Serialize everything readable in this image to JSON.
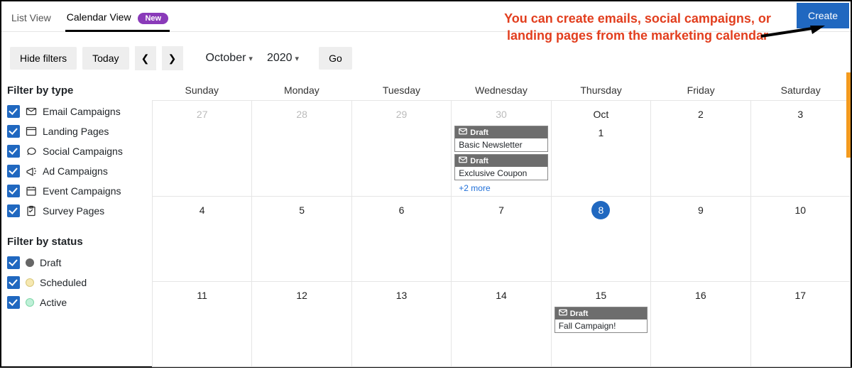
{
  "tabs": {
    "list": "List View",
    "calendar": "Calendar View",
    "newBadge": "New"
  },
  "createBtn": "Create",
  "annotationText": "You can create emails, social campaigns, or landing pages from the marketing calendar",
  "toolbar": {
    "hideFilters": "Hide filters",
    "today": "Today",
    "month": "October",
    "year": "2020",
    "go": "Go"
  },
  "filters": {
    "typeHeading": "Filter by type",
    "types": [
      "Email Campaigns",
      "Landing Pages",
      "Social Campaigns",
      "Ad Campaigns",
      "Event Campaigns",
      "Survey Pages"
    ],
    "statusHeading": "Filter by status",
    "statuses": [
      "Draft",
      "Scheduled",
      "Active"
    ]
  },
  "dayNames": [
    "Sunday",
    "Monday",
    "Tuesday",
    "Wednesday",
    "Thursday",
    "Friday",
    "Saturday"
  ],
  "rows": [
    [
      "27",
      "28",
      "29",
      "30",
      "Oct 1",
      "2",
      "3"
    ],
    [
      "4",
      "5",
      "6",
      "7",
      "8",
      "9",
      "10"
    ],
    [
      "11",
      "12",
      "13",
      "14",
      "15",
      "16",
      "17"
    ]
  ],
  "eventsDay30": {
    "draftLabel": "Draft",
    "items": [
      "Basic Newsletter",
      "Exclusive Coupon"
    ],
    "more": "+2 more"
  },
  "eventsDay15": {
    "draftLabel": "Draft",
    "item": "Fall Campaign!"
  }
}
